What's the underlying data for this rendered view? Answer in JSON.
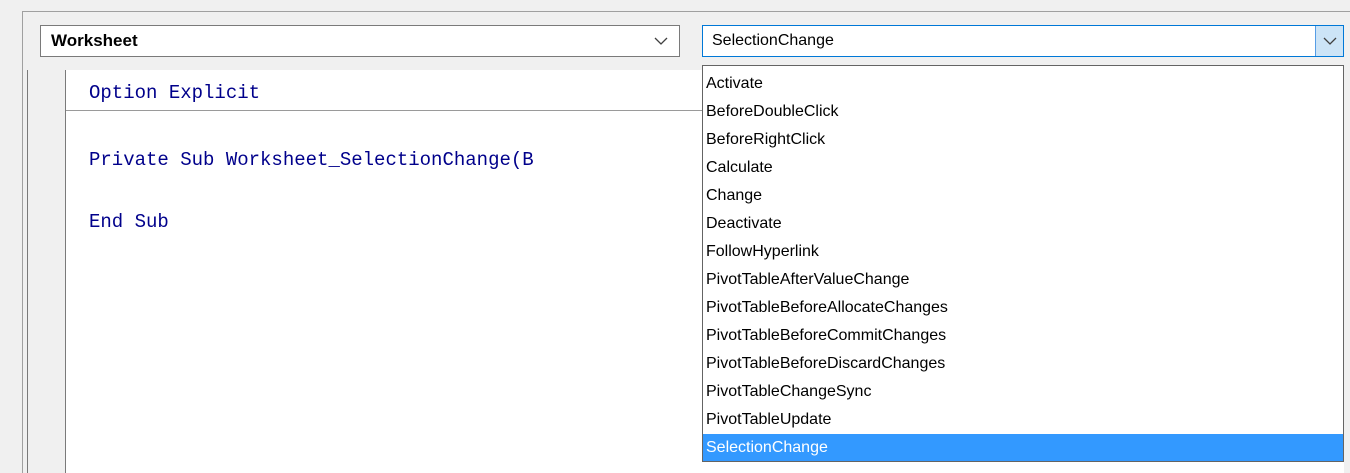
{
  "object_combo": {
    "value": "Worksheet"
  },
  "procedure_combo": {
    "value": "SelectionChange"
  },
  "code": {
    "lines": [
      "Option Explicit",
      "Private Sub Worksheet_SelectionChange(B",
      "End Sub"
    ]
  },
  "dropdown": {
    "items": [
      "Activate",
      "BeforeDoubleClick",
      "BeforeRightClick",
      "Calculate",
      "Change",
      "Deactivate",
      "FollowHyperlink",
      "PivotTableAfterValueChange",
      "PivotTableBeforeAllocateChanges",
      "PivotTableBeforeCommitChanges",
      "PivotTableBeforeDiscardChanges",
      "PivotTableChangeSync",
      "PivotTableUpdate",
      "SelectionChange"
    ],
    "selected_index": 13
  },
  "colors": {
    "keyword": "#00008b",
    "selection": "#3399ff",
    "focus_border": "#0078d7"
  },
  "icons": {
    "object_arrow": "chevron-down-icon",
    "procedure_arrow": "chevron-down-icon"
  }
}
